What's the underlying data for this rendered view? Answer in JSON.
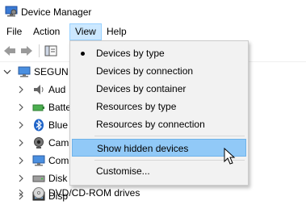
{
  "window": {
    "title": "Device Manager"
  },
  "menubar": {
    "file": "File",
    "action": "Action",
    "view": "View",
    "help": "Help"
  },
  "toolbar": {
    "back": "back-arrow-icon",
    "forward": "forward-arrow-icon",
    "properties": "properties-icon"
  },
  "tree": {
    "root": "SEGUN",
    "items": [
      {
        "label": "Aud",
        "icon": "audio-icon"
      },
      {
        "label": "Batte",
        "icon": "battery-icon"
      },
      {
        "label": "Blue",
        "icon": "bluetooth-icon"
      },
      {
        "label": "Cam",
        "icon": "camera-icon"
      },
      {
        "label": "Com",
        "icon": "computer-icon"
      },
      {
        "label": "Disk",
        "icon": "disk-drive-icon"
      },
      {
        "label": "Disp",
        "icon": "display-adapter-icon"
      },
      {
        "label": "DVD/CD-ROM drives",
        "icon": "dvd-drive-icon"
      }
    ]
  },
  "view_menu": {
    "items": [
      {
        "label": "Devices by type",
        "checked": true
      },
      {
        "label": "Devices by connection"
      },
      {
        "label": "Devices by container"
      },
      {
        "label": "Resources by type"
      },
      {
        "label": "Resources by connection"
      },
      {
        "label": "Show hidden devices",
        "highlighted": true
      },
      {
        "label": "Customise..."
      }
    ]
  },
  "colors": {
    "menu_highlight": "#91c9f7",
    "menu_bg": "#f2f2f2",
    "active_menu": "#cce8ff"
  }
}
